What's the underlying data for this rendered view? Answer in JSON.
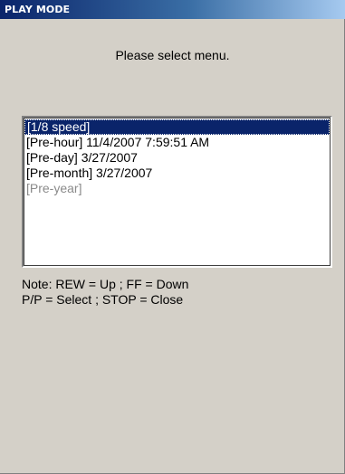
{
  "window": {
    "title": "PLAY MODE"
  },
  "prompt": "Please select menu.",
  "menu": {
    "items": [
      {
        "label": "[1/8 speed]",
        "state": "selected"
      },
      {
        "label": "[Pre-hour] 11/4/2007 7:59:51 AM",
        "state": "normal"
      },
      {
        "label": "[Pre-day] 3/27/2007",
        "state": "normal"
      },
      {
        "label": "[Pre-month] 3/27/2007",
        "state": "normal"
      },
      {
        "label": "[Pre-year]",
        "state": "disabled"
      }
    ]
  },
  "notes": {
    "line1": "Note: REW = Up ; FF = Down",
    "line2": "P/P = Select ; STOP = Close"
  },
  "colors": {
    "title_bar_start": "#0a246a",
    "title_bar_end": "#a6caf0",
    "selection": "#0a246a",
    "disabled_text": "#8a8a8a",
    "window_background": "#d4d0c8"
  }
}
